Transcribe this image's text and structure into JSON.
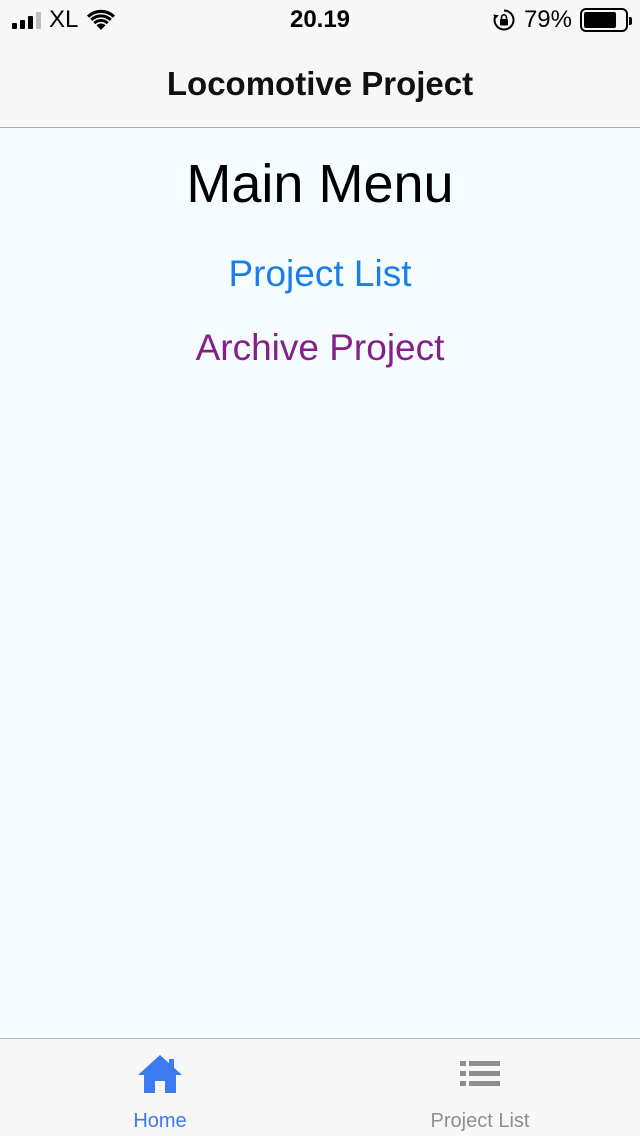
{
  "status_bar": {
    "carrier": "XL",
    "time": "20.19",
    "battery_percent": "79%",
    "battery_level": 0.79,
    "icons": [
      "signal-icon",
      "wifi-icon",
      "rotation-lock-icon",
      "battery-icon"
    ]
  },
  "nav": {
    "title": "Locomotive Project"
  },
  "main": {
    "title": "Main Menu",
    "links": {
      "project_list": "Project List",
      "archive_project": "Archive Project"
    }
  },
  "tab_bar": {
    "tabs": [
      {
        "label": "Home",
        "icon": "home-icon",
        "active": true
      },
      {
        "label": "Project List",
        "icon": "list-icon",
        "active": false
      }
    ]
  },
  "colors": {
    "active_tab": "#3b7af0",
    "inactive_tab": "#8e8e8e",
    "project_link": "#1a7ee8",
    "archive_link": "#852088",
    "content_bg": "#f5fcff"
  }
}
